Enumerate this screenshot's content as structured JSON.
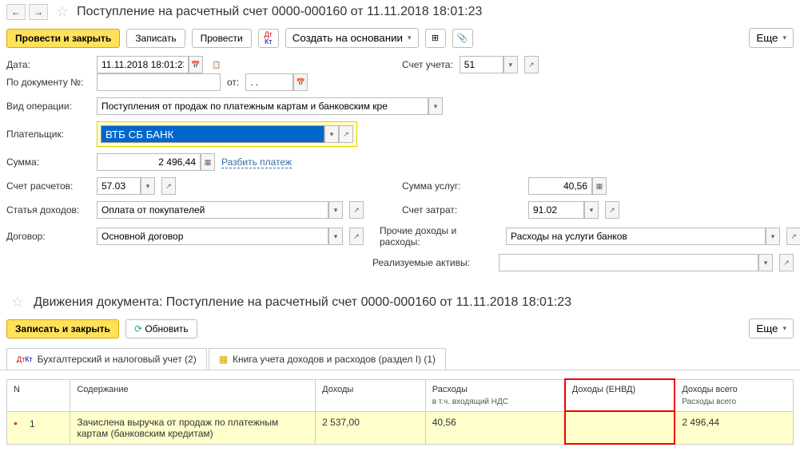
{
  "header": {
    "title": "Поступление на расчетный счет 0000-000160 от 11.11.2018 18:01:23"
  },
  "toolbar": {
    "post_close": "Провести и закрыть",
    "save": "Записать",
    "post": "Провести",
    "create_based": "Создать на основании",
    "more": "Еще"
  },
  "form": {
    "date_label": "Дата:",
    "date_value": "11.11.2018 18:01:23",
    "account_label": "Счет учета:",
    "account_value": "51",
    "doc_no_label": "По документу №:",
    "doc_no_value": "",
    "doc_from_label": "от:",
    "doc_from_value": ". .",
    "op_type_label": "Вид операции:",
    "op_type_value": "Поступления от продаж по платежным картам и банковским кре",
    "payer_label": "Плательщик:",
    "payer_value": "ВТБ СБ БАНК",
    "amount_label": "Сумма:",
    "amount_value": "2 496,44",
    "split_link": "Разбить платеж",
    "settlement_label": "Счет расчетов:",
    "settlement_value": "57.03",
    "svc_amount_label": "Сумма услуг:",
    "svc_amount_value": "40,56",
    "income_label": "Статья доходов:",
    "income_value": "Оплата от покупателей",
    "cost_account_label": "Счет затрат:",
    "cost_account_value": "91.02",
    "contract_label": "Договор:",
    "contract_value": "Основной договор",
    "other_label": "Прочие доходы и расходы:",
    "other_value": "Расходы на услуги банков",
    "assets_label": "Реализуемые активы:",
    "assets_value": ""
  },
  "movements": {
    "title": "Движения документа: Поступление на расчетный счет 0000-000160 от 11.11.2018 18:01:23",
    "save_close": "Записать и закрыть",
    "refresh": "Обновить",
    "more": "Еще"
  },
  "tabs": {
    "tab1": "Бухгалтерский и налоговый учет (2)",
    "tab2": "Книга учета доходов и расходов (раздел I) (1)"
  },
  "table": {
    "col_n": "N",
    "col_content": "Содержание",
    "col_income": "Доходы",
    "col_expense": "Расходы",
    "col_expense_sub": "в т.ч. входящий НДС",
    "col_envd": "Доходы (ЕНВД)",
    "col_total": "Доходы всего",
    "col_total_sub": "Расходы всего",
    "rows": [
      {
        "n": "1",
        "content": "Зачислена выручка от продаж по платежным картам (банковским кредитам)",
        "income": "2 537,00",
        "expense": "40,56",
        "envd": "",
        "total": "2 496,44"
      }
    ]
  }
}
